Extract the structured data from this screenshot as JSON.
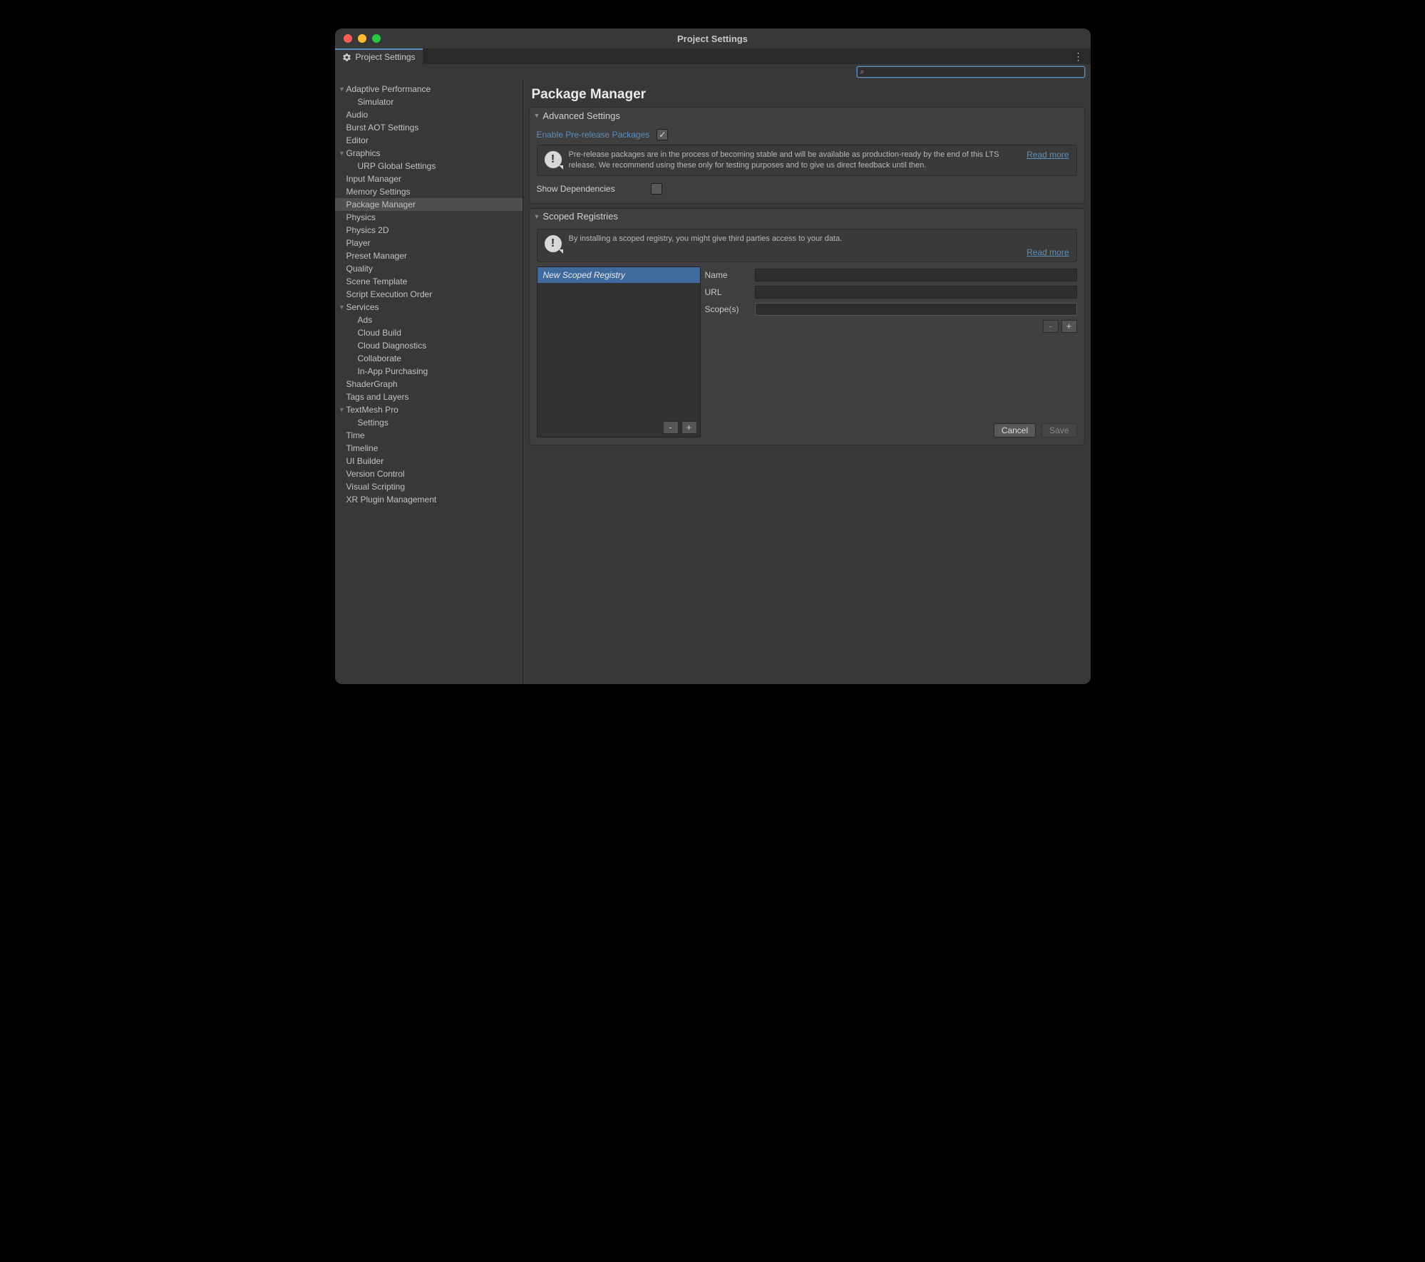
{
  "window": {
    "title": "Project Settings"
  },
  "tab": {
    "label": "Project Settings"
  },
  "search": {
    "value": ""
  },
  "sidebar": {
    "items": [
      {
        "label": "Adaptive Performance",
        "level": 0,
        "expandable": true
      },
      {
        "label": "Simulator",
        "level": 1,
        "expandable": false
      },
      {
        "label": "Audio",
        "level": 0,
        "expandable": false
      },
      {
        "label": "Burst AOT Settings",
        "level": 0,
        "expandable": false
      },
      {
        "label": "Editor",
        "level": 0,
        "expandable": false
      },
      {
        "label": "Graphics",
        "level": 0,
        "expandable": true
      },
      {
        "label": "URP Global Settings",
        "level": 1,
        "expandable": false
      },
      {
        "label": "Input Manager",
        "level": 0,
        "expandable": false
      },
      {
        "label": "Memory Settings",
        "level": 0,
        "expandable": false
      },
      {
        "label": "Package Manager",
        "level": 0,
        "expandable": false,
        "selected": true
      },
      {
        "label": "Physics",
        "level": 0,
        "expandable": false
      },
      {
        "label": "Physics 2D",
        "level": 0,
        "expandable": false
      },
      {
        "label": "Player",
        "level": 0,
        "expandable": false
      },
      {
        "label": "Preset Manager",
        "level": 0,
        "expandable": false
      },
      {
        "label": "Quality",
        "level": 0,
        "expandable": false
      },
      {
        "label": "Scene Template",
        "level": 0,
        "expandable": false
      },
      {
        "label": "Script Execution Order",
        "level": 0,
        "expandable": false
      },
      {
        "label": "Services",
        "level": 0,
        "expandable": true
      },
      {
        "label": "Ads",
        "level": 1,
        "expandable": false
      },
      {
        "label": "Cloud Build",
        "level": 1,
        "expandable": false
      },
      {
        "label": "Cloud Diagnostics",
        "level": 1,
        "expandable": false
      },
      {
        "label": "Collaborate",
        "level": 1,
        "expandable": false
      },
      {
        "label": "In-App Purchasing",
        "level": 1,
        "expandable": false
      },
      {
        "label": "ShaderGraph",
        "level": 0,
        "expandable": false
      },
      {
        "label": "Tags and Layers",
        "level": 0,
        "expandable": false
      },
      {
        "label": "TextMesh Pro",
        "level": 0,
        "expandable": true
      },
      {
        "label": "Settings",
        "level": 1,
        "expandable": false
      },
      {
        "label": "Time",
        "level": 0,
        "expandable": false
      },
      {
        "label": "Timeline",
        "level": 0,
        "expandable": false
      },
      {
        "label": "UI Builder",
        "level": 0,
        "expandable": false
      },
      {
        "label": "Version Control",
        "level": 0,
        "expandable": false
      },
      {
        "label": "Visual Scripting",
        "level": 0,
        "expandable": false
      },
      {
        "label": "XR Plugin Management",
        "level": 0,
        "expandable": false
      }
    ]
  },
  "page": {
    "title": "Package Manager",
    "advanced": {
      "heading": "Advanced Settings",
      "enable_pre_label": "Enable Pre-release Packages",
      "enable_pre_checked": true,
      "info": "Pre-release packages are in the process of becoming stable and will be available as production-ready by the end of this LTS release. We recommend using these only for testing purposes and to give us direct feedback until then.",
      "read_more": "Read more",
      "show_deps_label": "Show Dependencies",
      "show_deps_checked": false
    },
    "scoped": {
      "heading": "Scoped Registries",
      "warn": "By installing a scoped registry, you might give third parties access to your data.",
      "read_more": "Read more",
      "list_selected": "New Scoped Registry",
      "form": {
        "name_label": "Name",
        "name_value": "",
        "url_label": "URL",
        "url_value": "",
        "scopes_label": "Scope(s)",
        "scopes_value": ""
      },
      "buttons": {
        "list_remove": "-",
        "list_add": "+",
        "scope_remove": "-",
        "scope_add": "+",
        "cancel": "Cancel",
        "save": "Save"
      }
    }
  }
}
